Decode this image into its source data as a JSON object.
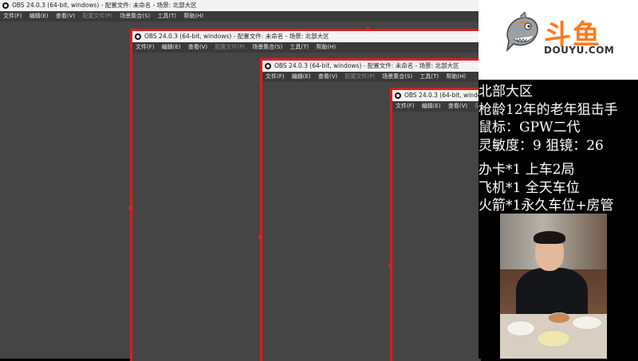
{
  "obs": {
    "title": "OBS 24.0.3 (64-bit, windows) - 配置文件: 未命名 - 场景: 北部大区",
    "menu": [
      "文件(F)",
      "编辑(E)",
      "查看(V)",
      "配置文件(P)",
      "场景集合(S)",
      "工具(T)",
      "帮助(H)"
    ],
    "menu_dim_index": 3
  },
  "brand": {
    "name": "斗鱼",
    "domain": "DOUYU.COM",
    "accent_color": "#ff7a1a"
  },
  "streamer_info": {
    "line1": "北部大区",
    "line2": "枪龄12年的老年狙击手",
    "line3": "鼠标：GPW二代",
    "line4": "灵敏度：9 狙镜：26",
    "line5": "办卡*1 上车2局",
    "line6": "飞机*1 全天车位",
    "line7": "火箭*1永久车位+房管"
  },
  "colors": {
    "highlight_red": "#d81e1e",
    "obs_background": "#454545"
  }
}
